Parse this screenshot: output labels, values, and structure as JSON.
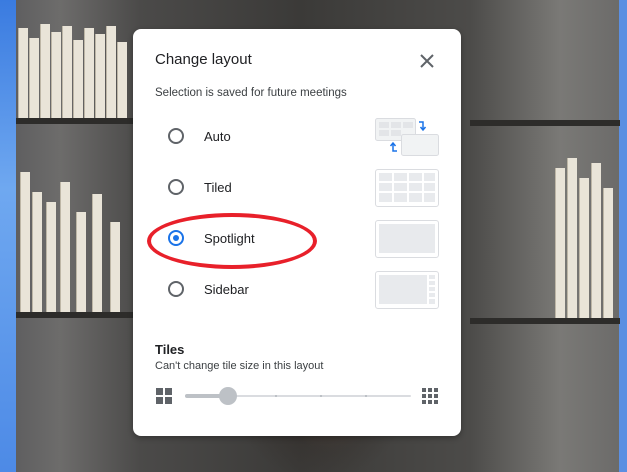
{
  "dialog": {
    "title": "Change layout",
    "subtitle": "Selection is saved for future meetings",
    "close_icon": "close-icon"
  },
  "layout_options": [
    {
      "label": "Auto",
      "selected": false,
      "icon": "auto-layout-icon"
    },
    {
      "label": "Tiled",
      "selected": false,
      "icon": "tiled-layout-icon"
    },
    {
      "label": "Spotlight",
      "selected": true,
      "icon": "spotlight-layout-icon"
    },
    {
      "label": "Sidebar",
      "selected": false,
      "icon": "sidebar-layout-icon"
    }
  ],
  "tiles": {
    "title": "Tiles",
    "note": "Can't change tile size in this layout",
    "min_icon": "small-grid-icon",
    "max_icon": "large-grid-icon",
    "disabled": true
  },
  "colors": {
    "accent": "#1a73e8",
    "annotation": "#e8202a"
  }
}
